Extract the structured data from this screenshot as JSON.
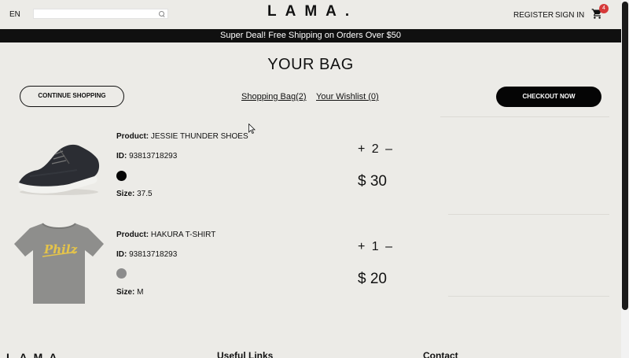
{
  "navbar": {
    "language": "EN",
    "search_placeholder": "",
    "logo": "LAMA.",
    "register": "REGISTER",
    "sign_in": "SIGN IN",
    "cart_count": "4"
  },
  "announcement": "Super Deal! Free Shipping on Orders Over $50",
  "page_title": "YOUR BAG",
  "top": {
    "continue_shopping": "CONTINUE SHOPPING",
    "shopping_bag": "Shopping Bag(2)",
    "wishlist": "Your Wishlist (0)",
    "checkout": "CHECKOUT NOW"
  },
  "labels": {
    "product": "Product:",
    "id": "ID:",
    "size": "Size:"
  },
  "products": [
    {
      "name": "JESSIE THUNDER SHOES",
      "id": "93813718293",
      "color": "#050505",
      "size": "37.5",
      "quantity": "+ 2 –",
      "price": "$ 30",
      "image_icon": "sneaker-image"
    },
    {
      "name": "HAKURA T-SHIRT",
      "id": "93813718293",
      "color": "#8c8c8c",
      "size": "M",
      "quantity": "+ 1 –",
      "price": "$ 20",
      "image_icon": "tshirt-image",
      "print_text": "Philz"
    }
  ],
  "footer": {
    "logo": "LAMA.",
    "useful_links": "Useful Links",
    "contact": "Contact"
  },
  "colors": {
    "background": "#ecebe7",
    "announcement_bg": "#101010",
    "badge": "#d63a3a",
    "checkout_bg": "#050505"
  }
}
